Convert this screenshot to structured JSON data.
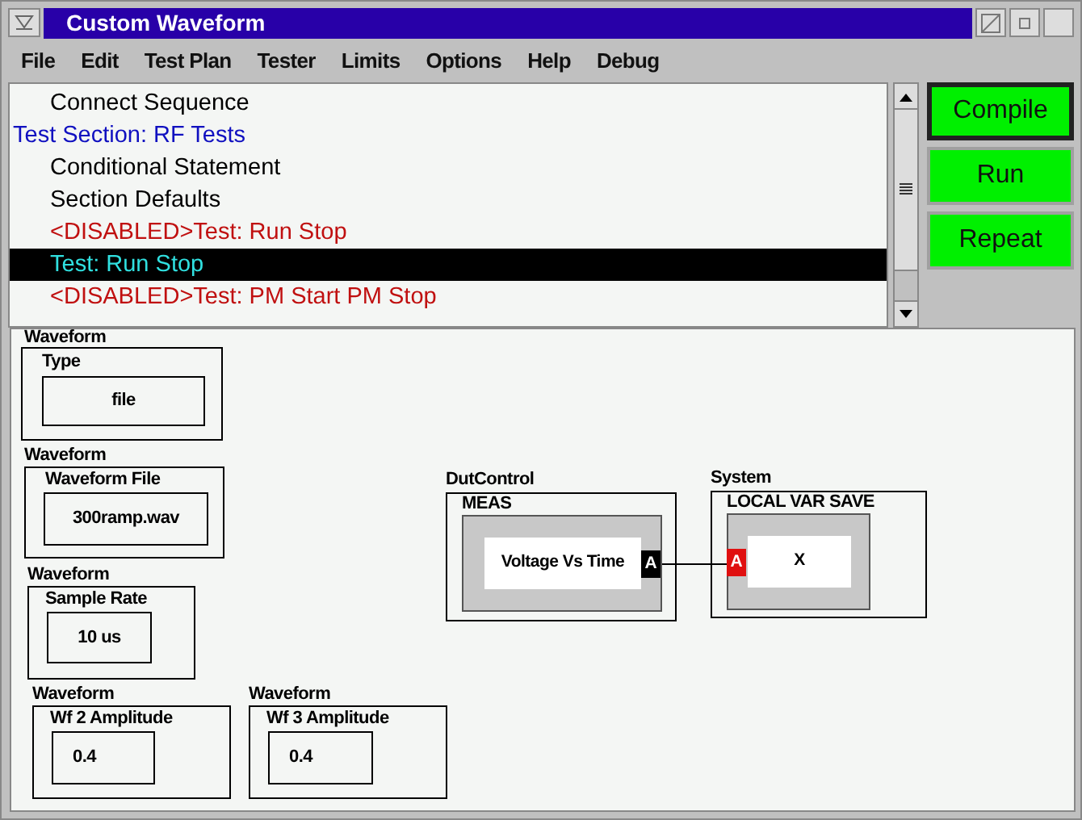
{
  "window": {
    "title": "Custom Waveform"
  },
  "menu": [
    "File",
    "Edit",
    "Test Plan",
    "Tester",
    "Limits",
    "Options",
    "Help",
    "Debug"
  ],
  "sequence": [
    {
      "kind": "item",
      "label": "Connect Sequence",
      "selected": false
    },
    {
      "kind": "section",
      "label": "Test Section: RF Tests",
      "selected": false
    },
    {
      "kind": "item",
      "label": "Conditional Statement",
      "selected": false
    },
    {
      "kind": "item",
      "label": "Section Defaults",
      "selected": false
    },
    {
      "kind": "disabled",
      "label": "<DISABLED>Test: Run Stop",
      "selected": false
    },
    {
      "kind": "item",
      "label": "Test: Run Stop",
      "selected": true
    },
    {
      "kind": "disabled",
      "label": "<DISABLED>Test: PM Start PM Stop",
      "selected": false
    }
  ],
  "buttons": [
    {
      "label": "Compile",
      "default": true
    },
    {
      "label": "Run",
      "default": false
    },
    {
      "label": "Repeat",
      "default": false
    }
  ],
  "diagram": {
    "nodes": [
      {
        "kind": "parameter",
        "group": "Waveform",
        "name": "Type",
        "value": "file"
      },
      {
        "kind": "parameter",
        "group": "Waveform",
        "name": "Waveform File",
        "value": "300ramp.wav"
      },
      {
        "kind": "parameter",
        "group": "Waveform",
        "name": "Sample Rate",
        "value": "10 us"
      },
      {
        "kind": "parameter",
        "group": "Waveform",
        "name": "Wf 2 Amplitude",
        "value": "0.4"
      },
      {
        "kind": "parameter",
        "group": "Waveform",
        "name": "Wf 3 Amplitude",
        "value": "0.4"
      },
      {
        "kind": "producer",
        "group": "DutControl",
        "name": "MEAS",
        "value": "Voltage Vs Time",
        "port": "A"
      },
      {
        "kind": "consumer",
        "group": "System",
        "name": "LOCAL VAR SAVE",
        "value": "X",
        "port": "A"
      }
    ]
  }
}
